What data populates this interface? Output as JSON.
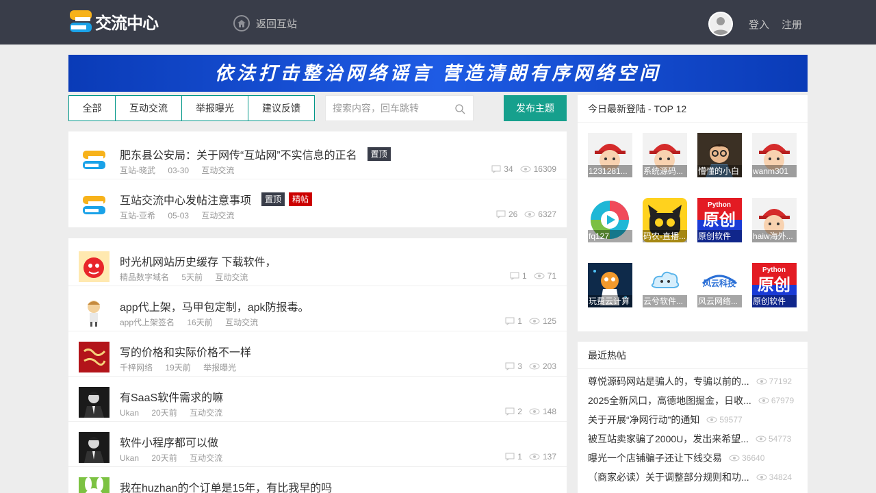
{
  "header": {
    "logo_text": "交流中心",
    "back_label": "返回互站",
    "login_label": "登入",
    "register_label": "注册"
  },
  "banner": {
    "text": "依法打击整治网络谣言  营造清朗有序网络空间"
  },
  "tabs": [
    {
      "label": "全部"
    },
    {
      "label": "互动交流"
    },
    {
      "label": "举报曝光"
    },
    {
      "label": "建议反馈"
    }
  ],
  "search": {
    "placeholder": "搜索内容，回车跳转"
  },
  "post_button": "发布主题",
  "pinned": [
    {
      "title": "肥东县公安局：关于网传“互站网”不实信息的正名",
      "badges": [
        "置顶"
      ],
      "author": "互站-晓武",
      "time": "03-30",
      "category": "互动交流",
      "comments": "34",
      "views": "16309"
    },
    {
      "title": "互站交流中心发帖注意事项",
      "badges": [
        "置顶",
        "精帖"
      ],
      "author": "互站-亚希",
      "time": "05-03",
      "category": "互动交流",
      "comments": "26",
      "views": "6327"
    }
  ],
  "posts": [
    {
      "title": "时光机网站历史缓存 下载软件，",
      "author": "精品数字域名",
      "time": "5天前",
      "category": "互动交流",
      "comments": "1",
      "views": "71",
      "avatar": "red-mascot"
    },
    {
      "title": "app代上架，马甲包定制，apk防报毒。",
      "author": "app代上架签名",
      "time": "16天前",
      "category": "互动交流",
      "comments": "1",
      "views": "125",
      "avatar": "cartoon-boy"
    },
    {
      "title": "写的价格和实际价格不一样",
      "author": "千梓网络",
      "time": "19天前",
      "category": "举报曝光",
      "comments": "3",
      "views": "203",
      "avatar": "red-calligraphy"
    },
    {
      "title": "有SaaS软件需求的嘛",
      "author": "Ukan",
      "time": "20天前",
      "category": "互动交流",
      "comments": "2",
      "views": "148",
      "avatar": "dark-portrait"
    },
    {
      "title": "软件小程序都可以做",
      "author": "Ukan",
      "time": "20天前",
      "category": "互动交流",
      "comments": "1",
      "views": "137",
      "avatar": "dark-portrait"
    },
    {
      "title": "我在huzhan的个订单是15年，有比我早的吗",
      "author": "",
      "time": "",
      "category": "",
      "comments": "",
      "views": "",
      "avatar": "rabbit"
    }
  ],
  "top_users": {
    "title": "今日最新登陆 - TOP 12",
    "users": [
      {
        "name": "1231281...",
        "avatar": "cap-kid"
      },
      {
        "name": "系统源码...",
        "avatar": "cap-kid"
      },
      {
        "name": "懵懂的小白",
        "avatar": "cartoon-boy"
      },
      {
        "name": "wanm301",
        "avatar": "cap-kid"
      },
      {
        "name": "fq127",
        "avatar": "colorful-ring"
      },
      {
        "name": "码农-直播...",
        "avatar": "yellow-cat"
      },
      {
        "name": "原创软件",
        "avatar": "python-original",
        "tile_label": "Python",
        "tile_text": "原创"
      },
      {
        "name": "haiw海外...",
        "avatar": "cap-kid"
      },
      {
        "name": "玩费云计算",
        "avatar": "cloud-mascot"
      },
      {
        "name": "云兮软件...",
        "avatar": "cloud-logo"
      },
      {
        "name": "风云网络...",
        "avatar": "fengyun-logo",
        "tile_text": "风云科技"
      },
      {
        "name": "原创软件",
        "avatar": "python-original",
        "tile_label": "Python",
        "tile_text": "原创"
      }
    ]
  },
  "hot_posts": {
    "title": "最近热帖",
    "items": [
      {
        "title": "尊悦源码网站是骗人的，专骗以前的...",
        "views": "77192"
      },
      {
        "title": "2025全新风口，高德地图掘金，日收...",
        "views": "67979"
      },
      {
        "title": "关于开展“净网行动”的通知",
        "views": "59577"
      },
      {
        "title": "被互站卖家骗了2000U，发出来希望...",
        "views": "54773"
      },
      {
        "title": "曝光一个店铺骗子还让下线交易",
        "views": "36640"
      },
      {
        "title": "（商家必读）关于调整部分规则和功...",
        "views": "34824"
      }
    ]
  },
  "colors": {
    "header_bg": "#393d49",
    "accent": "#16a08d",
    "badge_top": "#393d49",
    "badge_best": "#cc0000",
    "banner_bg": "#0a3bb7"
  }
}
